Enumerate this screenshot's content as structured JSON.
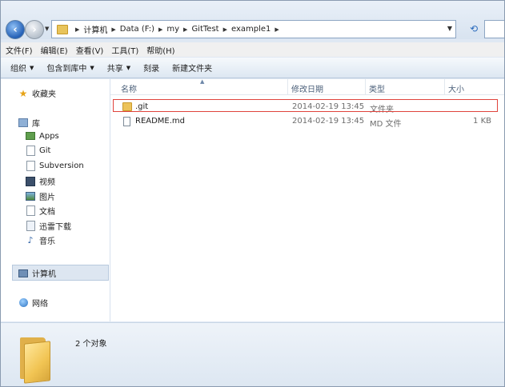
{
  "address": {
    "segments": [
      "计算机",
      "Data (F:)",
      "my",
      "GitTest",
      "example1"
    ]
  },
  "menu": [
    "文件(F)",
    "编辑(E)",
    "查看(V)",
    "工具(T)",
    "帮助(H)"
  ],
  "commands": [
    {
      "label": "组织",
      "dropdown": true
    },
    {
      "label": "包含到库中",
      "dropdown": true
    },
    {
      "label": "共享",
      "dropdown": true
    },
    {
      "label": "刻录",
      "dropdown": false
    },
    {
      "label": "新建文件夹",
      "dropdown": false
    }
  ],
  "nav": {
    "favorites": "收藏夹",
    "libraries": "库",
    "library_items": [
      "Apps",
      "Git",
      "Subversion",
      "视频",
      "图片",
      "文档",
      "迅雷下载",
      "音乐"
    ],
    "computer": "计算机",
    "network": "网络"
  },
  "columns": {
    "name": "名称",
    "modified": "修改日期",
    "type": "类型",
    "size": "大小"
  },
  "files": [
    {
      "name": ".git",
      "modified": "2014-02-19 13:45",
      "type": "文件夹",
      "size": "",
      "kind": "folder"
    },
    {
      "name": "README.md",
      "modified": "2014-02-19 13:45",
      "type": "MD 文件",
      "size": "1 KB",
      "kind": "file"
    }
  ],
  "details": {
    "status": "2 个对象"
  },
  "colors": {
    "highlight_box": "#e0443d",
    "selection": "#dde6f1"
  }
}
